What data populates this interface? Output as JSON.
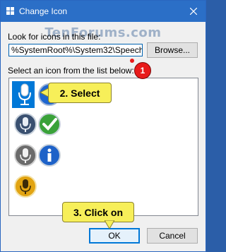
{
  "window": {
    "title": "Change Icon",
    "watermark": "TenForums.com"
  },
  "form": {
    "look_label": "Look for icons in this file:",
    "path_value": "%SystemRoot%\\System32\\Speech\\Sp",
    "browse_label": "Browse...",
    "select_label": "Select an icon from the list below:"
  },
  "icons": [
    {
      "name": "microphone-icon",
      "selected": true
    },
    {
      "name": "info-icon-partial"
    },
    {
      "name": "microphone-dark-icon"
    },
    {
      "name": "checkmark-icon"
    },
    {
      "name": "microphone-gray-icon"
    },
    {
      "name": "info-icon"
    },
    {
      "name": "microphone-gold-icon"
    }
  ],
  "buttons": {
    "ok_label": "OK",
    "cancel_label": "Cancel"
  },
  "annotations": {
    "step1_badge": "1",
    "step2_callout": "2. Select",
    "step3_callout": "3. Click on"
  },
  "colors": {
    "title_bar": "#2b6fc7",
    "selection": "#0078d7",
    "callout_fill": "#f7ef59",
    "badge_red": "#e81b1b"
  }
}
